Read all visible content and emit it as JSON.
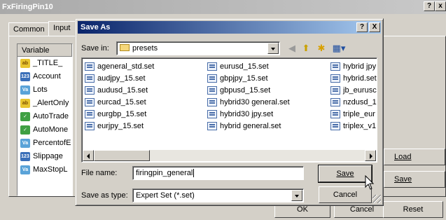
{
  "outer_window": {
    "title": "FxFiringPin10",
    "help_btn": "?",
    "close_btn": "x",
    "tabs": [
      "Common",
      "Input"
    ],
    "variable_header": "Variable",
    "variables": [
      {
        "name": "_TITLE_",
        "type_icon": "ab"
      },
      {
        "name": "Account",
        "type_icon": "123"
      },
      {
        "name": "Lots",
        "type_icon": "Va"
      },
      {
        "name": "_AlertOnly",
        "type_icon": "ab"
      },
      {
        "name": "AutoTrade",
        "type_icon": "bool"
      },
      {
        "name": "AutoMone",
        "type_icon": "bool"
      },
      {
        "name": "PercentofE",
        "type_icon": "Va"
      },
      {
        "name": "Slippage",
        "type_icon": "123"
      },
      {
        "name": "MaxStopL",
        "type_icon": "Va"
      }
    ],
    "load_button": "Load",
    "save_button": "Save",
    "ok_button": "OK",
    "cancel_button": "Cancel",
    "reset_button": "Reset"
  },
  "save_dialog": {
    "title": "Save As",
    "help_btn": "?",
    "close_btn": "X",
    "save_in_label": "Save in:",
    "save_in_value": "presets",
    "toolbar_icons": [
      "back-icon",
      "up-folder-icon",
      "new-folder-icon",
      "view-menu-icon"
    ],
    "files_col1": [
      "ageneral_std.set",
      "audjpy_15.set",
      "audusd_15.set",
      "eurcad_15.set",
      "eurgbp_15.set",
      "eurjpy_15.set"
    ],
    "files_col2": [
      "eurusd_15.set",
      "gbpjpy_15.set",
      "gbpusd_15.set",
      "hybrid30 general.set",
      "hybrid30 jpy.set",
      "hybrid general.set"
    ],
    "files_col3": [
      "hybrid jpy",
      "hybrid.set",
      "jb_eurusc",
      "nzdusd_1",
      "triple_eur",
      "triplex_v1"
    ],
    "file_name_label": "File name:",
    "file_name_value": "firingpin_general",
    "save_as_type_label": "Save as type:",
    "save_as_type_value": "Expert Set (*.set)",
    "save_button": "Save",
    "cancel_button": "Cancel"
  }
}
